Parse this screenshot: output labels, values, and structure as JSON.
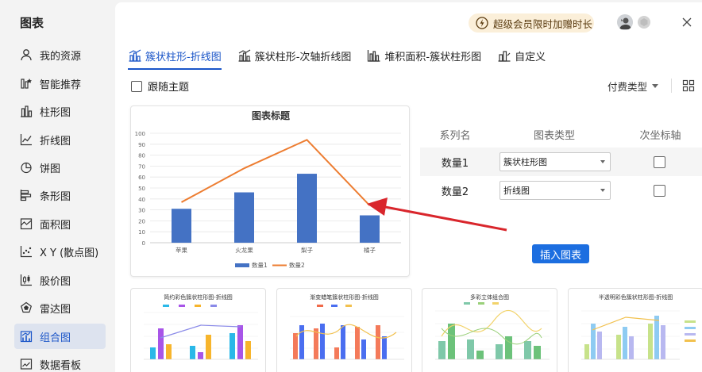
{
  "sidebar": {
    "title": "图表",
    "items": [
      {
        "label": "我的资源",
        "icon": "user-icon"
      },
      {
        "label": "智能推荐",
        "icon": "smart-recommend-icon"
      },
      {
        "label": "柱形图",
        "icon": "column-chart-icon"
      },
      {
        "label": "折线图",
        "icon": "line-chart-icon"
      },
      {
        "label": "饼图",
        "icon": "pie-chart-icon"
      },
      {
        "label": "条形图",
        "icon": "bar-chart-icon"
      },
      {
        "label": "面积图",
        "icon": "area-chart-icon"
      },
      {
        "label": "X Y (散点图)",
        "icon": "scatter-chart-icon"
      },
      {
        "label": "股价图",
        "icon": "stock-chart-icon"
      },
      {
        "label": "雷达图",
        "icon": "radar-chart-icon"
      },
      {
        "label": "组合图",
        "icon": "combo-chart-icon",
        "active": true
      },
      {
        "label": "数据看板",
        "icon": "dashboard-icon"
      }
    ]
  },
  "header": {
    "promo": "超级会员限时加赠时长"
  },
  "tabs": [
    {
      "label": "簇状柱形-折线图",
      "active": true
    },
    {
      "label": "簇状柱形-次轴折线图"
    },
    {
      "label": "堆积面积-簇状柱形图"
    },
    {
      "label": "自定义"
    }
  ],
  "toolbar": {
    "follow_theme": "跟随主题",
    "paid_type": "付费类型"
  },
  "chart_data": {
    "type": "bar",
    "title": "图表标题",
    "categories": [
      "苹果",
      "火龙果",
      "梨子",
      "橘子"
    ],
    "series": [
      {
        "name": "数量1",
        "type": "bar",
        "color": "#4472c4",
        "values": [
          31,
          46,
          63,
          25
        ]
      },
      {
        "name": "数量2",
        "type": "line",
        "color": "#ed7d31",
        "values": [
          37,
          68,
          94,
          34
        ]
      }
    ],
    "yticks": [
      "0",
      "10",
      "20",
      "30",
      "40",
      "50",
      "60",
      "70",
      "80",
      "90",
      "100"
    ],
    "ylim": [
      0,
      100
    ],
    "legend": "bottom",
    "grid": true
  },
  "series_table": {
    "headers": [
      "系列名",
      "图表类型",
      "次坐标轴"
    ],
    "rows": [
      {
        "name": "数量1",
        "type": "簇状柱形图"
      },
      {
        "name": "数量2",
        "type": "折线图"
      }
    ]
  },
  "insert_label": "插入图表",
  "templates": [
    {
      "title": "简约彩色簇状柱形图-折线图"
    },
    {
      "title": "渐变蜡笔簇状柱形图-折线图"
    },
    {
      "title": "多彩立体组合图"
    },
    {
      "title": "半透明彩色簇状柱形图-折线图"
    }
  ],
  "colors": {
    "accent": "#1a55c8",
    "button": "#1c6ee0",
    "arrow": "#d9262c"
  }
}
